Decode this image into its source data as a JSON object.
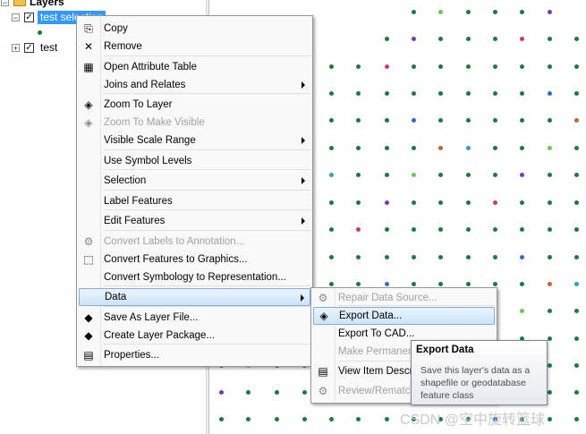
{
  "toc": {
    "title": "Layers",
    "layers": [
      {
        "name": "test selection",
        "checked": true,
        "expander": "⊟"
      },
      {
        "name": "test",
        "checked": true,
        "expander": "⊞"
      }
    ]
  },
  "context_menu": {
    "items": [
      {
        "label": "Copy",
        "icon": "copy-icon",
        "glyph": "⎘"
      },
      {
        "label": "Remove",
        "icon": "remove-icon",
        "glyph": "✕"
      },
      {
        "label": "Open Attribute Table",
        "icon": "table-icon",
        "glyph": "▦"
      },
      {
        "label": "Joins and Relates",
        "icon": "",
        "glyph": ""
      },
      {
        "label": "Zoom To Layer",
        "icon": "zoom-to-layer-icon",
        "glyph": "◈"
      },
      {
        "label": "Zoom To Make Visible",
        "icon": "zoom-visible-icon",
        "glyph": "◈"
      },
      {
        "label": "Visible Scale Range",
        "icon": "",
        "glyph": ""
      },
      {
        "label": "Use Symbol Levels",
        "icon": "",
        "glyph": ""
      },
      {
        "label": "Selection",
        "icon": "",
        "glyph": ""
      },
      {
        "label": "Label Features",
        "icon": "",
        "glyph": ""
      },
      {
        "label": "Edit Features",
        "icon": "",
        "glyph": ""
      },
      {
        "label": "Convert Labels to Annotation...",
        "icon": "convert-labels-icon",
        "glyph": "⚙"
      },
      {
        "label": "Convert Features to Graphics...",
        "icon": "convert-features-icon",
        "glyph": "⬚"
      },
      {
        "label": "Convert Symbology to Representation...",
        "icon": "",
        "glyph": ""
      },
      {
        "label": "Data",
        "icon": "",
        "glyph": ""
      },
      {
        "label": "Save As Layer File...",
        "icon": "layer-file-icon",
        "glyph": "◆"
      },
      {
        "label": "Create Layer Package...",
        "icon": "layer-package-icon",
        "glyph": "◆"
      },
      {
        "label": "Properties...",
        "icon": "properties-icon",
        "glyph": "▤"
      }
    ]
  },
  "data_submenu": {
    "items": [
      {
        "label": "Repair Data Source...",
        "icon": "repair-icon",
        "glyph": "⚙"
      },
      {
        "label": "Export Data...",
        "icon": "export-data-icon",
        "glyph": "◈"
      },
      {
        "label": "Export To CAD...",
        "icon": "",
        "glyph": ""
      },
      {
        "label": "Make Permaner",
        "icon": "",
        "glyph": ""
      },
      {
        "label": "View Item Descri",
        "icon": "view-item-icon",
        "glyph": "▤"
      },
      {
        "label": "Review/Rematch",
        "icon": "review-icon",
        "glyph": "⚙"
      }
    ]
  },
  "tooltip": {
    "title": "Export Data",
    "body": "Save this layer's data as a shapefile or geodatabase feature class"
  },
  "watermark": "CSDN @空中旋转篮球",
  "colors": {
    "selection": "#3399ff",
    "menu_highlight_border": "#84acdd",
    "point_green": "#1d7a3a",
    "point_blue": "#2f6fb7",
    "point_orange": "#c0653a",
    "point_purple": "#7b3aa8",
    "point_cyan": "#2aa6b8",
    "point_pink": "#c8387d",
    "point_light_green": "#67c85a"
  }
}
